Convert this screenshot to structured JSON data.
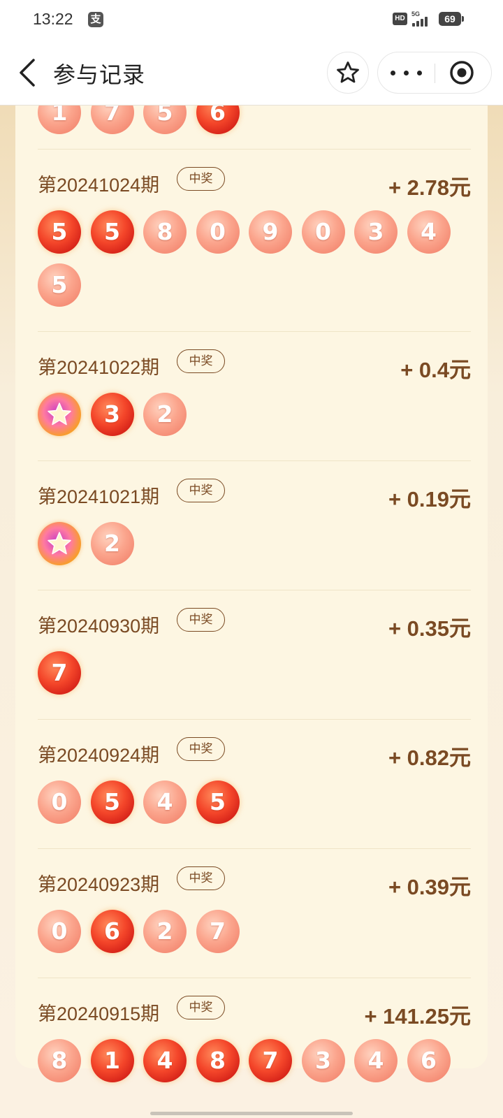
{
  "status_bar": {
    "time": "13:22",
    "app_icon_char": "支",
    "hd_label": "HD",
    "network": "5G",
    "battery": "69"
  },
  "nav": {
    "title": "参与记录"
  },
  "badge_label": "中奖",
  "top_partial_balls": [
    {
      "n": "1",
      "style": "pink"
    },
    {
      "n": "7",
      "style": "pink"
    },
    {
      "n": "5",
      "style": "pink"
    },
    {
      "n": "6",
      "style": "red"
    }
  ],
  "records": [
    {
      "period": "第20241024期",
      "amount": "+ 2.78元",
      "balls": [
        {
          "n": "5",
          "style": "red"
        },
        {
          "n": "5",
          "style": "red"
        },
        {
          "n": "8",
          "style": "pink"
        },
        {
          "n": "0",
          "style": "pink"
        },
        {
          "n": "9",
          "style": "pink"
        },
        {
          "n": "0",
          "style": "pink"
        },
        {
          "n": "3",
          "style": "pink"
        },
        {
          "n": "4",
          "style": "pink"
        },
        {
          "n": "5",
          "style": "pink"
        }
      ]
    },
    {
      "period": "第20241022期",
      "amount": "+ 0.4元",
      "balls": [
        {
          "n": "",
          "style": "star"
        },
        {
          "n": "3",
          "style": "red"
        },
        {
          "n": "2",
          "style": "pink"
        }
      ]
    },
    {
      "period": "第20241021期",
      "amount": "+ 0.19元",
      "balls": [
        {
          "n": "",
          "style": "star"
        },
        {
          "n": "2",
          "style": "pink"
        }
      ]
    },
    {
      "period": "第20240930期",
      "amount": "+ 0.35元",
      "balls": [
        {
          "n": "7",
          "style": "red"
        }
      ]
    },
    {
      "period": "第20240924期",
      "amount": "+ 0.82元",
      "balls": [
        {
          "n": "0",
          "style": "pink"
        },
        {
          "n": "5",
          "style": "red"
        },
        {
          "n": "4",
          "style": "pink"
        },
        {
          "n": "5",
          "style": "red"
        }
      ]
    },
    {
      "period": "第20240923期",
      "amount": "+ 0.39元",
      "balls": [
        {
          "n": "0",
          "style": "pink"
        },
        {
          "n": "6",
          "style": "red"
        },
        {
          "n": "2",
          "style": "pink"
        },
        {
          "n": "7",
          "style": "pink"
        }
      ]
    },
    {
      "period": "第20240915期",
      "amount": "+ 141.25元",
      "balls": [
        {
          "n": "8",
          "style": "pink"
        },
        {
          "n": "1",
          "style": "red"
        },
        {
          "n": "4",
          "style": "red"
        },
        {
          "n": "8",
          "style": "red"
        },
        {
          "n": "7",
          "style": "red"
        },
        {
          "n": "3",
          "style": "pink"
        },
        {
          "n": "4",
          "style": "pink"
        },
        {
          "n": "6",
          "style": "pink"
        }
      ]
    }
  ]
}
